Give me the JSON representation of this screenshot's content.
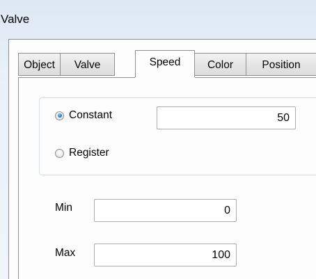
{
  "window": {
    "title": "Valve"
  },
  "tabs": [
    {
      "label": "Object",
      "active": false
    },
    {
      "label": "Valve",
      "active": false
    },
    {
      "label": "Speed",
      "active": true
    },
    {
      "label": "Color",
      "active": false
    },
    {
      "label": "Position",
      "active": false
    }
  ],
  "speed": {
    "source_options": [
      {
        "label": "Constant",
        "selected": true
      },
      {
        "label": "Register",
        "selected": false
      }
    ],
    "constant_value": "50",
    "min_label": "Min",
    "min_value": "0",
    "max_label": "Max",
    "max_value": "100"
  },
  "colors": {
    "accent": "#2a74c4",
    "border": "#8f8f8f",
    "background": "#eaf1f9"
  }
}
